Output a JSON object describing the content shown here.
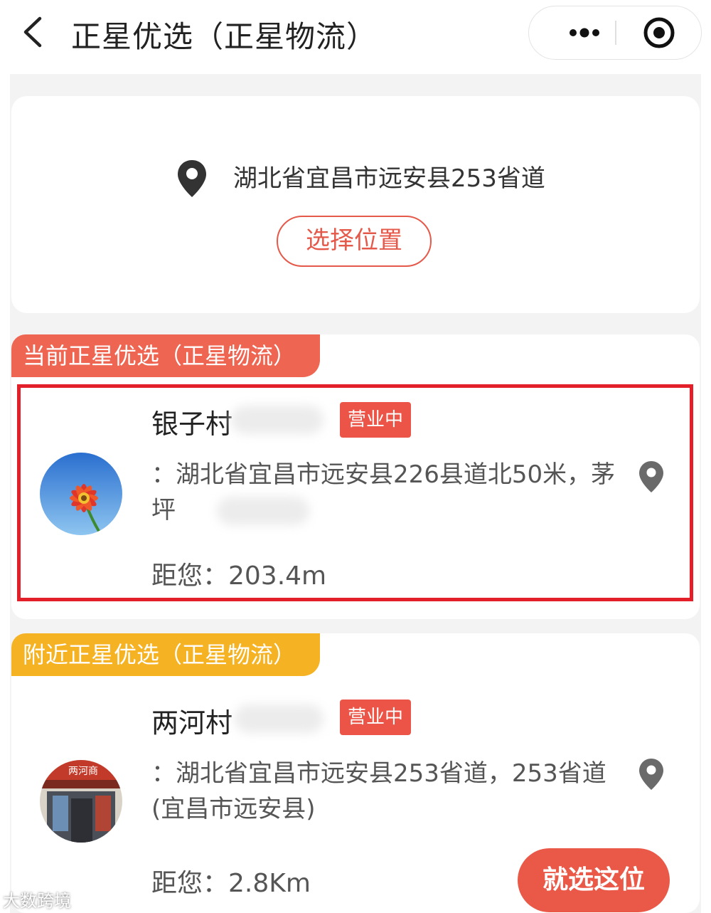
{
  "nav": {
    "title": "正星优选（正星物流）",
    "more_icon": "more-dots-icon",
    "record_icon": "target-icon"
  },
  "location": {
    "address": "湖北省宜昌市远安县253省道",
    "choose_label": "选择位置"
  },
  "current": {
    "section_label": "当前正星优选（正星物流）",
    "store": {
      "name": "银子村",
      "status": "营业中",
      "address": "：湖北省宜昌市远安县226县道北50米，茅坪",
      "distance": "距您：203.4m"
    }
  },
  "nearby": {
    "section_label": "附近正星优选（正星物流）",
    "store": {
      "name": "两河村",
      "status": "营业中",
      "address": "：湖北省宜昌市远安县253省道，253省道(宜昌市远安县)",
      "distance": "距您：2.8Km",
      "select_label": "就选这位",
      "shop_sign_text": "两河商"
    }
  },
  "watermark": "大数跨境",
  "colors": {
    "accent": "#e4594a",
    "current_tag": "#ee6552",
    "nearby_tag": "#f5b223",
    "highlight": "#e3202a"
  }
}
